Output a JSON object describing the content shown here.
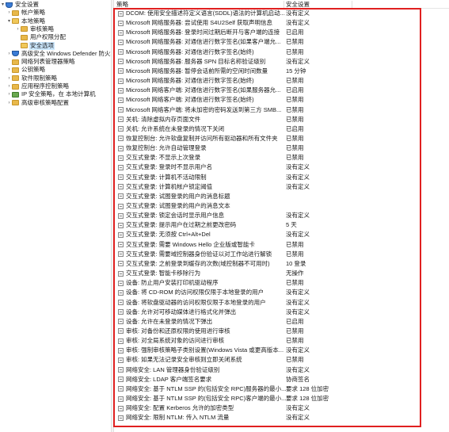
{
  "tree": {
    "items": [
      {
        "label": "安全设置",
        "level": 0,
        "expanded": true,
        "icon": "shield-folder-icon"
      },
      {
        "label": "帐户策略",
        "level": 1,
        "expanded": false,
        "icon": "folder-icon"
      },
      {
        "label": "本地策略",
        "level": 1,
        "expanded": true,
        "icon": "open-folder-icon"
      },
      {
        "label": "审核策略",
        "level": 2,
        "expanded": false,
        "icon": "folder-icon"
      },
      {
        "label": "用户权限分配",
        "level": 2,
        "expanded": null,
        "icon": "folder-icon"
      },
      {
        "label": "安全选项",
        "level": 2,
        "expanded": null,
        "icon": "open-folder-icon",
        "selected": true
      },
      {
        "label": "高级安全 Windows Defender 防火墙",
        "level": 1,
        "expanded": false,
        "icon": "shield-icon"
      },
      {
        "label": "网络列表管理器策略",
        "level": 1,
        "expanded": null,
        "icon": "folder-icon"
      },
      {
        "label": "公钥策略",
        "level": 1,
        "expanded": false,
        "icon": "folder-icon"
      },
      {
        "label": "软件限制策略",
        "level": 1,
        "expanded": false,
        "icon": "folder-icon"
      },
      {
        "label": "应用程序控制策略",
        "level": 1,
        "expanded": false,
        "icon": "folder-icon"
      },
      {
        "label": "IP 安全策略，在 本地计算机",
        "level": 1,
        "expanded": false,
        "icon": "network-icon"
      },
      {
        "label": "高级审核策略配置",
        "level": 1,
        "expanded": false,
        "icon": "folder-icon"
      }
    ]
  },
  "list": {
    "headers": {
      "policy": "策略",
      "setting": "安全设置"
    },
    "rows": [
      {
        "name": "DCOM: 使用安全描述符定义语言(SDDL)语法的计算机启动...",
        "value": "没有定义"
      },
      {
        "name": "Microsoft 网络服务器: 尝试使用 S4U2Self 获取声明信息",
        "value": "没有定义"
      },
      {
        "name": "Microsoft 网络服务器: 登录时间过期后断开与客户端的连接",
        "value": "已启用"
      },
      {
        "name": "Microsoft 网络服务器: 对通信进行数字签名(如果客户端允...",
        "value": "已禁用"
      },
      {
        "name": "Microsoft 网络服务器: 对通信进行数字签名(始终)",
        "value": "已禁用"
      },
      {
        "name": "Microsoft 网络服务器: 服务器 SPN 目标名称验证级别",
        "value": "没有定义"
      },
      {
        "name": "Microsoft 网络服务器: 暂停会话前所需的空闲时间数量",
        "value": "15 分钟"
      },
      {
        "name": "Microsoft 网络服务器: 对通信进行数字签名(始终)",
        "value": "已禁用"
      },
      {
        "name": "Microsoft 网络客户端: 对通信进行数字签名(如果服务器允...",
        "value": "已启用"
      },
      {
        "name": "Microsoft 网络客户端: 对通信进行数字签名(始终)",
        "value": "已禁用"
      },
      {
        "name": "Microsoft 网络客户端: 将未加密的密码发送到第三方 SMB...",
        "value": "已禁用"
      },
      {
        "name": "关机: 清除虚拟内存页面文件",
        "value": "已禁用"
      },
      {
        "name": "关机: 允许系统在未登录的情况下关闭",
        "value": "已启用"
      },
      {
        "name": "恢复控制台: 允许软盘复制并访问所有驱动器和所有文件夹",
        "value": "已禁用"
      },
      {
        "name": "恢复控制台: 允许自动管理登录",
        "value": "已禁用"
      },
      {
        "name": "交互式登录: 不显示上次登录",
        "value": "已禁用"
      },
      {
        "name": "交互式登录: 登录时不显示用户名",
        "value": "没有定义"
      },
      {
        "name": "交互式登录: 计算机不活动限制",
        "value": "没有定义"
      },
      {
        "name": "交互式登录: 计算机帐户锁定阈值",
        "value": "没有定义"
      },
      {
        "name": "交互式登录: 试图登录的用户的消息标题",
        "value": ""
      },
      {
        "name": "交互式登录: 试图登录的用户的消息文本",
        "value": ""
      },
      {
        "name": "交互式登录: 锁定会话时显示用户信息",
        "value": "没有定义"
      },
      {
        "name": "交互式登录: 提示用户在过期之前更改密码",
        "value": "5 天"
      },
      {
        "name": "交互式登录: 无须按 Ctrl+Alt+Del",
        "value": "没有定义"
      },
      {
        "name": "交互式登录: 需要 Windows Hello 企业版或智能卡",
        "value": "已禁用"
      },
      {
        "name": "交互式登录: 需要域控制器身份验证以对工作站进行解锁",
        "value": "已禁用"
      },
      {
        "name": "交互式登录: 之前登录到缓存的次数(域控制器不可用时)",
        "value": "10 登录"
      },
      {
        "name": "交互式登录: 智能卡移除行为",
        "value": "无操作"
      },
      {
        "name": "设备: 防止用户安装打印机驱动程序",
        "value": "已禁用"
      },
      {
        "name": "设备: 将 CD-ROM 的访问权限仅限于本地登录的用户",
        "value": "没有定义"
      },
      {
        "name": "设备: 将软盘驱动器的访问权限仅限于本地登录的用户",
        "value": "没有定义"
      },
      {
        "name": "设备: 允许对可移动媒体进行格式化并弹出",
        "value": "没有定义"
      },
      {
        "name": "设备: 允许在未登录的情况下弹出",
        "value": "已启用"
      },
      {
        "name": "审核: 对备份和还原权限的使用进行审核",
        "value": "已禁用"
      },
      {
        "name": "审核: 对全局系统对象的访问进行审核",
        "value": "已禁用"
      },
      {
        "name": "审核: 强制审核策略子类别设置(Windows Vista 或更高版本...",
        "value": "没有定义"
      },
      {
        "name": "审核: 如果无法记录安全审核则立即关闭系统",
        "value": "已禁用"
      },
      {
        "name": "网络安全: LAN 管理器身份验证级别",
        "value": "没有定义"
      },
      {
        "name": "网络安全: LDAP 客户端签名要求",
        "value": "协商签名"
      },
      {
        "name": "网络安全: 基于 NTLM SSP 的(包括安全 RPC)服务器的最小...",
        "value": "要求 128 位加密"
      },
      {
        "name": "网络安全: 基于 NTLM SSP 的(包括安全 RPC)客户端的最小...",
        "value": "要求 128 位加密"
      },
      {
        "name": "网络安全: 配置 Kerberos 允许的加密类型",
        "value": "没有定义"
      },
      {
        "name": "网络安全: 限制 NTLM: 传入 NTLM 流量",
        "value": "没有定义"
      }
    ]
  },
  "colors": {
    "highlight_box": "#e02020",
    "selection": "#cce8ff"
  }
}
